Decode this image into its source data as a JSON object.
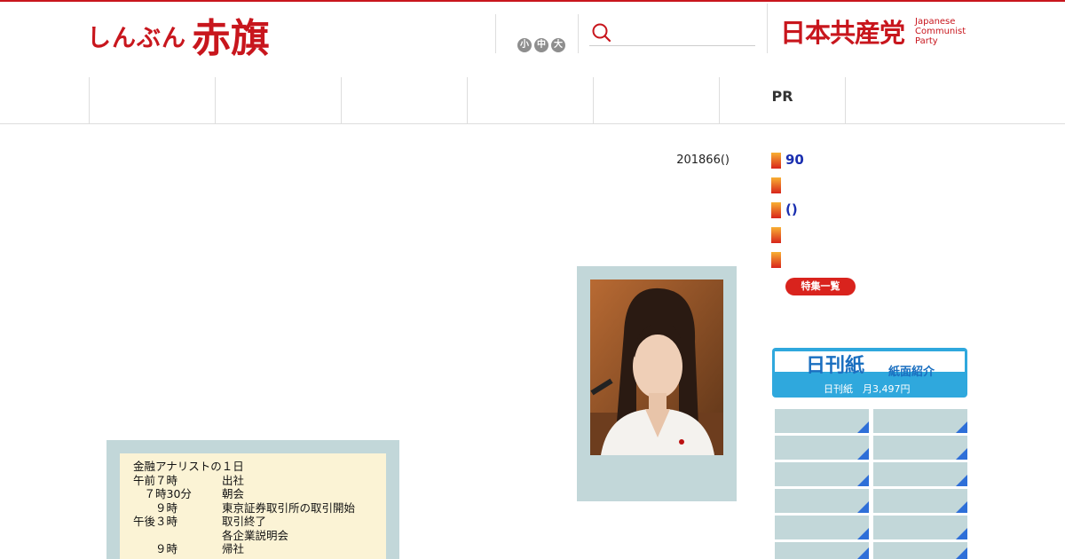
{
  "header": {
    "logo_kana": "しんぶん",
    "logo_kanji": "赤旗",
    "font_size_buttons": [
      "小",
      "中",
      "大"
    ],
    "search_placeholder": "",
    "jcp_logo": "日本共産党",
    "jcp_english": [
      "Japanese",
      "Communist",
      "Party"
    ],
    "brand_color": "#c8161d"
  },
  "nav": {
    "items": [
      "",
      "",
      "",
      "",
      "",
      "PR"
    ]
  },
  "article": {
    "date": "201866()"
  },
  "schedule_table": {
    "title": "金融アナリストの１日",
    "rows": [
      {
        "time": "午前７時",
        "event": "出社"
      },
      {
        "time": "　７時30分",
        "event": "朝会"
      },
      {
        "time": "　　９時",
        "event": "東京証券取引所の取引開始"
      },
      {
        "time": "午後３時",
        "event": "取引終了"
      },
      {
        "time": "",
        "event": "各企業説明会"
      },
      {
        "time": "　　９時",
        "event": "帰社"
      }
    ]
  },
  "sidebar": {
    "items": [
      "90",
      "",
      "()",
      "",
      ""
    ],
    "tokushu_button": "特集一覧",
    "nikkan": {
      "title": "日刊紙",
      "subtitle": "紙面紹介",
      "price": "日刊紙　月3,497円"
    }
  }
}
